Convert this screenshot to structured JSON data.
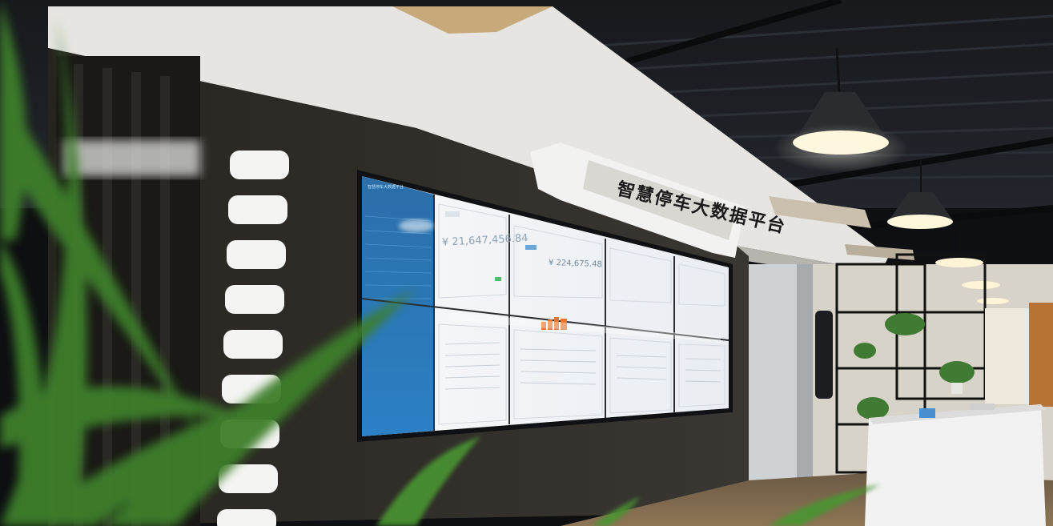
{
  "scene": {
    "sign_text": "智慧停车大数据平台",
    "screen": {
      "sidebar_title": "智慧停车大数据平台",
      "menu_items": [
        "",
        "",
        "",
        "",
        "",
        "",
        "",
        ""
      ],
      "amount_primary": "¥ 21,647,456.84",
      "amount_secondary": "¥ 224,675.48",
      "accent_color": "#2f8fd8",
      "bar_color": "#e8752a",
      "highlight_color": "#47c26b"
    },
    "colors": {
      "ceiling": "#1b1d22",
      "wall": "#2f2d2c",
      "sign_panel": "#f2f2f0",
      "lamp_light": "#fff7dc",
      "plant": "#3d7f2a"
    }
  }
}
